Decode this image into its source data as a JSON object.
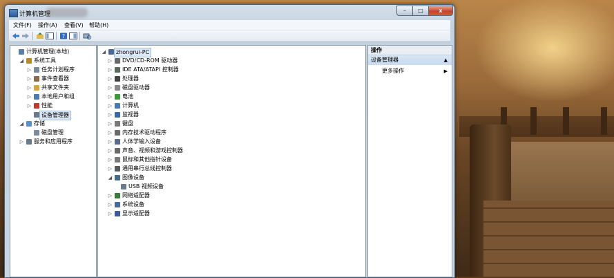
{
  "window": {
    "title": "计算机管理"
  },
  "menu": [
    "文件(F)",
    "操作(A)",
    "查看(V)",
    "帮助(H)"
  ],
  "window_buttons": {
    "minimize": "–",
    "maximize": "□",
    "close": "x"
  },
  "left_tree": [
    {
      "label": "计算机管理(本地)",
      "level": 0,
      "expander": "",
      "icon": "computer-management-icon",
      "color": "#5b7fa8"
    },
    {
      "label": "系统工具",
      "level": 1,
      "expander": "◢",
      "icon": "system-tools-icon",
      "color": "#b58a2a"
    },
    {
      "label": "任务计划程序",
      "level": 2,
      "expander": "▷",
      "icon": "clock-icon",
      "color": "#7a8a9a"
    },
    {
      "label": "事件查看器",
      "level": 2,
      "expander": "▷",
      "icon": "event-viewer-icon",
      "color": "#8a6a4a"
    },
    {
      "label": "共享文件夹",
      "level": 2,
      "expander": "▷",
      "icon": "shared-folder-icon",
      "color": "#d4a73a"
    },
    {
      "label": "本地用户和组",
      "level": 2,
      "expander": "▷",
      "icon": "users-icon",
      "color": "#4a7ab0"
    },
    {
      "label": "性能",
      "level": 2,
      "expander": "▷",
      "icon": "performance-icon",
      "color": "#c0392b"
    },
    {
      "label": "设备管理器",
      "level": 2,
      "expander": "",
      "icon": "device-manager-icon",
      "color": "#6a7a8a",
      "selected": true
    },
    {
      "label": "存储",
      "level": 1,
      "expander": "◢",
      "icon": "storage-icon",
      "color": "#5b8fc7"
    },
    {
      "label": "磁盘管理",
      "level": 2,
      "expander": "",
      "icon": "disk-management-icon",
      "color": "#7a8a9a"
    },
    {
      "label": "服务和应用程序",
      "level": 1,
      "expander": "▷",
      "icon": "services-icon",
      "color": "#6a7a8a"
    }
  ],
  "device_tree": [
    {
      "label": "zhongrui-PC",
      "level": 0,
      "expander": "◢",
      "icon": "pc-icon",
      "color": "#4a6a9a",
      "selected": true
    },
    {
      "label": "DVD/CD-ROM 驱动器",
      "level": 1,
      "expander": "▷",
      "icon": "dvd-icon",
      "color": "#6a6a6a"
    },
    {
      "label": "IDE ATA/ATAPI 控制器",
      "level": 1,
      "expander": "▷",
      "icon": "ide-icon",
      "color": "#5a6a5a"
    },
    {
      "label": "处理器",
      "level": 1,
      "expander": "▷",
      "icon": "processor-icon",
      "color": "#444444"
    },
    {
      "label": "磁盘驱动器",
      "level": 1,
      "expander": "▷",
      "icon": "disk-drive-icon",
      "color": "#8a8a8a"
    },
    {
      "label": "电池",
      "level": 1,
      "expander": "▷",
      "icon": "battery-icon",
      "color": "#3a9a3a"
    },
    {
      "label": "计算机",
      "level": 1,
      "expander": "▷",
      "icon": "computer-icon",
      "color": "#4a7ab0"
    },
    {
      "label": "监视器",
      "level": 1,
      "expander": "▷",
      "icon": "monitor-icon",
      "color": "#3a6aa0"
    },
    {
      "label": "键盘",
      "level": 1,
      "expander": "▷",
      "icon": "keyboard-icon",
      "color": "#7a7a7a"
    },
    {
      "label": "内存技术驱动程序",
      "level": 1,
      "expander": "▷",
      "icon": "memory-icon",
      "color": "#6a6a6a"
    },
    {
      "label": "人体学输入设备",
      "level": 1,
      "expander": "▷",
      "icon": "hid-icon",
      "color": "#5a6a8a"
    },
    {
      "label": "声音、视频和游戏控制器",
      "level": 1,
      "expander": "▷",
      "icon": "sound-icon",
      "color": "#6a6a6a"
    },
    {
      "label": "鼠标和其他指针设备",
      "level": 1,
      "expander": "▷",
      "icon": "mouse-icon",
      "color": "#7a7a7a"
    },
    {
      "label": "通用串行总线控制器",
      "level": 1,
      "expander": "▷",
      "icon": "usb-icon",
      "color": "#5a5a5a"
    },
    {
      "label": "图像设备",
      "level": 1,
      "expander": "◢",
      "icon": "imaging-icon",
      "color": "#4a6a8a"
    },
    {
      "label": "USB 视频设备",
      "level": 2,
      "expander": "",
      "icon": "camera-icon",
      "color": "#6a7a8a"
    },
    {
      "label": "网络适配器",
      "level": 1,
      "expander": "▷",
      "icon": "network-icon",
      "color": "#3a7a3a"
    },
    {
      "label": "系统设备",
      "level": 1,
      "expander": "▷",
      "icon": "system-device-icon",
      "color": "#4a6a9a"
    },
    {
      "label": "显示适配器",
      "level": 1,
      "expander": "▷",
      "icon": "display-adapter-icon",
      "color": "#3a5a9a"
    }
  ],
  "actions": {
    "header": "操作",
    "selected": "设备管理器",
    "selected_arrow": "▲",
    "more": "更多操作",
    "more_arrow": "▶"
  }
}
